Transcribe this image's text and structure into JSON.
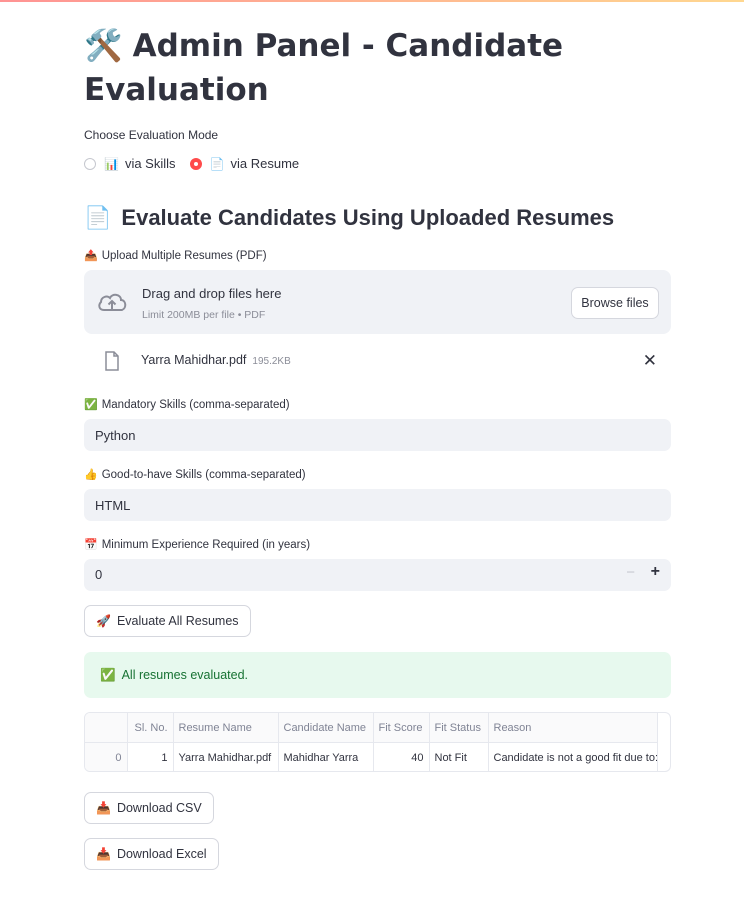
{
  "page": {
    "title": "Admin Panel - Candidate Evaluation",
    "title_icon": "🛠️"
  },
  "mode": {
    "label": "Choose Evaluation Mode",
    "options": [
      {
        "icon": "📊",
        "label": "via Skills",
        "selected": false
      },
      {
        "icon": "📄",
        "label": "via Resume",
        "selected": true
      }
    ]
  },
  "section": {
    "icon": "📄",
    "title": "Evaluate Candidates Using Uploaded Resumes"
  },
  "uploader": {
    "icon": "📤",
    "label": "Upload Multiple Resumes (PDF)",
    "drop_text": "Drag and drop files here",
    "limit_text": "Limit 200MB per file • PDF",
    "browse_label": "Browse files",
    "file": {
      "name": "Yarra Mahidhar.pdf",
      "size": "195.2KB"
    }
  },
  "mandatory": {
    "icon": "✅",
    "label": "Mandatory Skills (comma-separated)",
    "value": "Python"
  },
  "good_to_have": {
    "icon": "👍",
    "label": "Good-to-have Skills (comma-separated)",
    "value": "HTML"
  },
  "experience": {
    "icon": "📅",
    "label": "Minimum Experience Required (in years)",
    "value": "0",
    "minus": "−",
    "plus": "+"
  },
  "evaluate_button": {
    "icon": "🚀",
    "label": "Evaluate All Resumes"
  },
  "alert": {
    "icon": "✅",
    "text": "All resumes evaluated."
  },
  "results_table": {
    "columns": [
      "",
      "Sl. No.",
      "Resume Name",
      "Candidate Name",
      "Fit Score",
      "Fit Status",
      "Reason"
    ],
    "rows": [
      [
        "0",
        "1",
        "Yarra Mahidhar.pdf",
        "Mahidhar Yarra",
        "40",
        "Not Fit",
        "Candidate is not a good fit due to:"
      ]
    ]
  },
  "download_csv": {
    "icon": "📥",
    "label": "Download CSV"
  },
  "download_excel": {
    "icon": "📥",
    "label": "Download Excel"
  }
}
